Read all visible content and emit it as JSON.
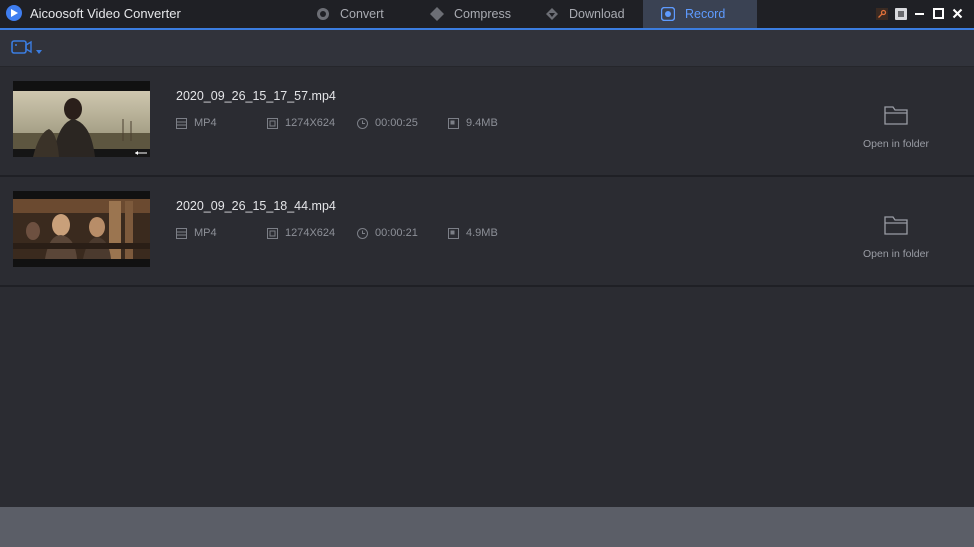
{
  "app": {
    "title": "Aicoosoft Video Converter"
  },
  "tabs": [
    {
      "label": "Convert",
      "icon": "convert-icon"
    },
    {
      "label": "Compress",
      "icon": "compress-icon"
    },
    {
      "label": "Download",
      "icon": "download-icon"
    },
    {
      "label": "Record",
      "icon": "record-icon",
      "active": true
    }
  ],
  "colors": {
    "accent": "#3b7de0",
    "active_tab_text": "#5e9bff",
    "background": "#2b2c32"
  },
  "files": [
    {
      "name": "2020_09_26_15_17_57.mp4",
      "format": "MP4",
      "resolution": "1274X624",
      "duration": "00:00:25",
      "size": "9.4MB",
      "open_label": "Open in folder"
    },
    {
      "name": "2020_09_26_15_18_44.mp4",
      "format": "MP4",
      "resolution": "1274X624",
      "duration": "00:00:21",
      "size": "4.9MB",
      "open_label": "Open in folder"
    }
  ]
}
